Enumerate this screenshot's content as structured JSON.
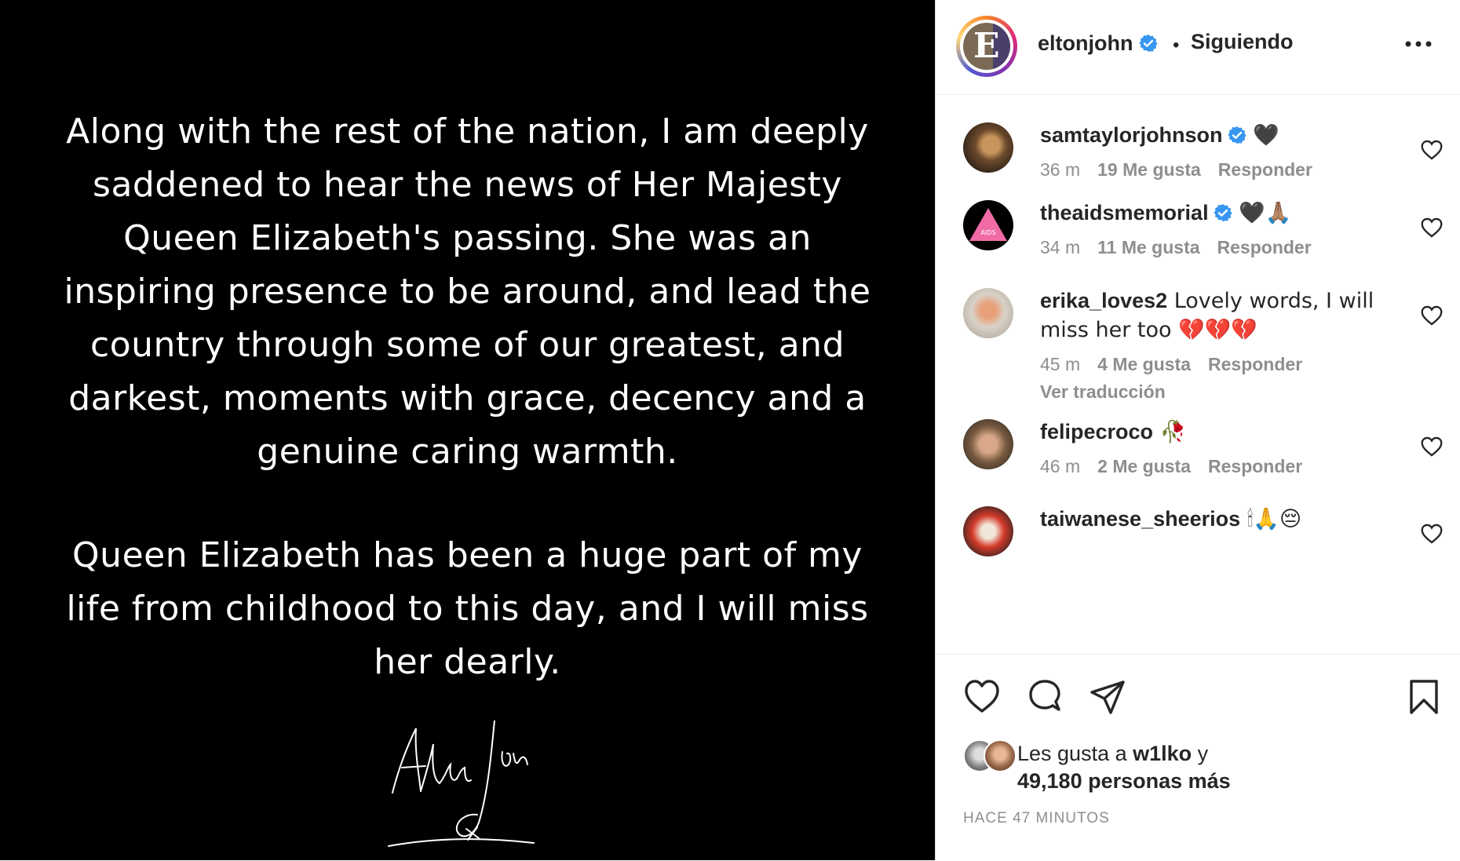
{
  "post": {
    "paragraph1": "Along with the rest of the nation, I am deeply saddened to hear the news of Her Majesty Queen Elizabeth's passing. She was an inspiring presence to be around, and lead the country through some of our greatest, and darkest, moments with grace, decency and a genuine caring warmth.",
    "paragraph2": "Queen Elizabeth has been a huge part of my life from childhood to this day, and I will miss her dearly.",
    "signature": "Elton John"
  },
  "header": {
    "username": "eltonjohn",
    "separator": "•",
    "follow_status": "Siguiendo",
    "more_icon": "more-horizontal-icon"
  },
  "comments": [
    {
      "username": "samtaylorjohnson",
      "verified": true,
      "text": " 🖤",
      "time": "36 m",
      "likes": "19 Me gusta",
      "reply": "Responder"
    },
    {
      "username": "theaidsmemorial",
      "verified": true,
      "text": " 🖤🙏🏽",
      "time": "34 m",
      "likes": "11 Me gusta",
      "reply": "Responder"
    },
    {
      "username": "erika_loves2",
      "verified": false,
      "text": " Lovely words, I will miss her too 💔💔💔",
      "time": "45 m",
      "likes": "4 Me gusta",
      "reply": "Responder",
      "translate": "Ver traducción"
    },
    {
      "username": "felipecroco",
      "verified": false,
      "text": " 🥀",
      "time": "46 m",
      "likes": "2 Me gusta",
      "reply": "Responder"
    },
    {
      "username": "taiwanese_sheerios",
      "verified": false,
      "text": " 🕯🙏😔",
      "time": "",
      "likes": "",
      "reply": ""
    }
  ],
  "actions": {
    "icons": [
      "heart-icon",
      "comment-icon",
      "share-icon",
      "bookmark-icon"
    ]
  },
  "likes": {
    "prefix": "Les gusta a ",
    "user": "w1lko",
    "suffix": " y",
    "count_text": "49,180 personas más"
  },
  "timestamp": "HACE 47 MINUTOS"
}
